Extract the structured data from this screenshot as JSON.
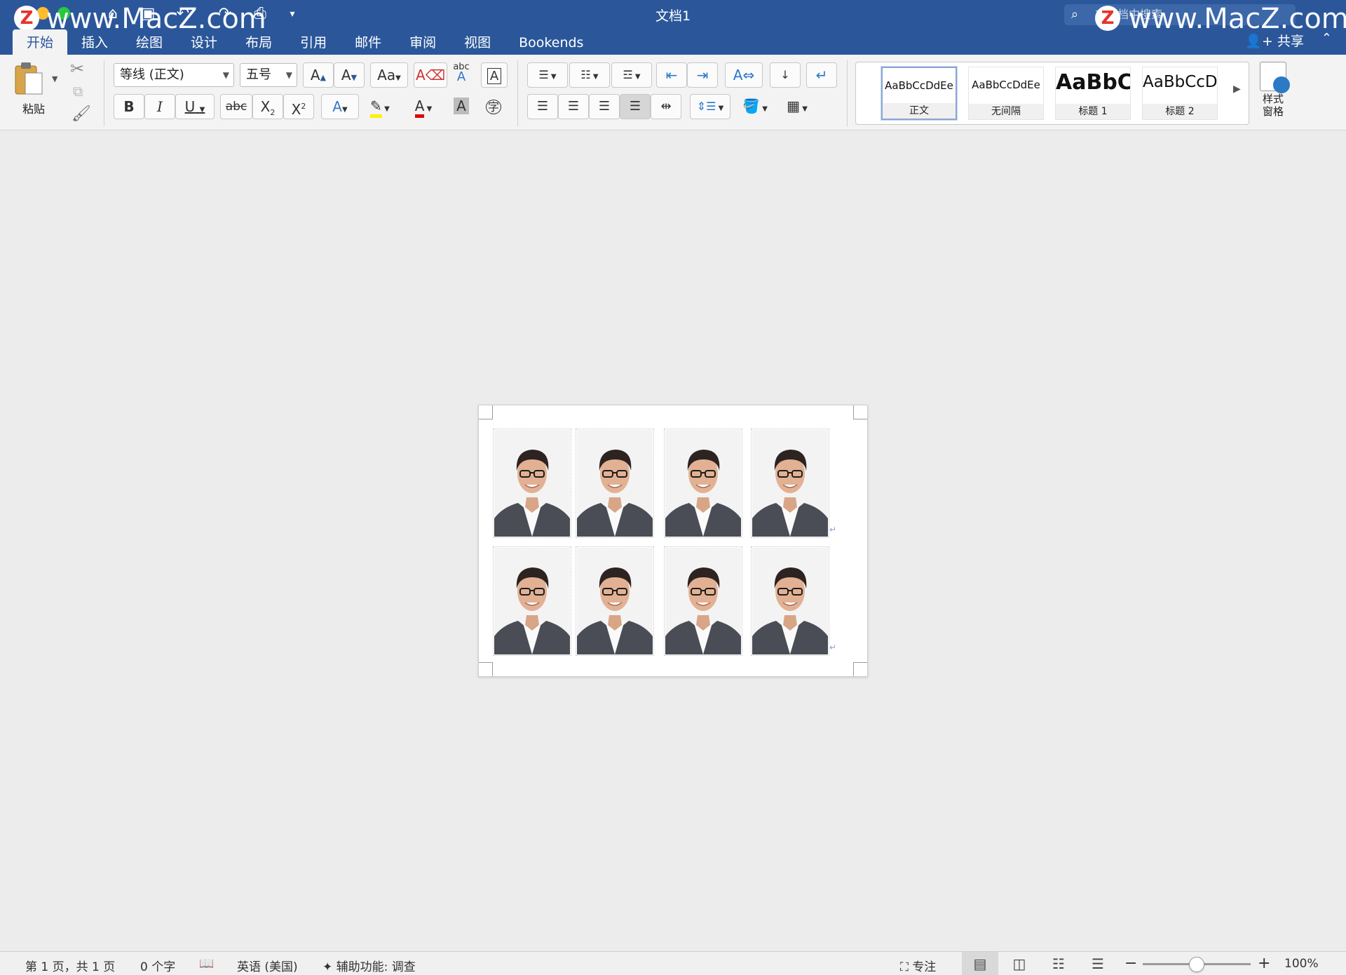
{
  "window": {
    "title": "文档1",
    "search_placeholder": "在文档中搜索",
    "watermark_text": "www.MacZ.com",
    "watermark_logo": "Z",
    "share_label": "共享"
  },
  "tabs": [
    "开始",
    "插入",
    "绘图",
    "设计",
    "布局",
    "引用",
    "邮件",
    "审阅",
    "视图",
    "Bookends"
  ],
  "active_tab": "开始",
  "ribbon": {
    "paste_label": "粘贴",
    "font_name": "等线 (正文)",
    "font_size": "五号",
    "grow_font": "A",
    "shrink_font": "A",
    "change_case": "Aa",
    "bold": "B",
    "italic": "I",
    "underline": "U",
    "strikethrough": "abc",
    "subscript": "X",
    "superscript": "X",
    "text_effects": "A",
    "font_color": "A",
    "char_shading": "A",
    "enclose_char": "字",
    "abc": "abc",
    "styles": [
      {
        "sample": "AaBbCcDdEe",
        "name": "正文"
      },
      {
        "sample": "AaBbCcDdEe",
        "name": "无间隔"
      },
      {
        "sample": "AaBbC",
        "name": "标题 1"
      },
      {
        "sample": "AaBbCcD",
        "name": "标题 2"
      }
    ],
    "styles_pane_label_1": "样式",
    "styles_pane_label_2": "窗格"
  },
  "status": {
    "page_info": "第 1 页，共 1 页",
    "word_count": "0 个字",
    "language": "英语 (美国)",
    "accessibility": "辅助功能: 调查",
    "focus": "专注",
    "zoom": "100%",
    "zoom_fraction": 0.5
  },
  "colors": {
    "titlebar": "#2b579a",
    "highlight_yellow": "#ffef00",
    "font_red": "#e00000"
  },
  "document": {
    "photo_rows": 2,
    "photo_cols": 4
  }
}
